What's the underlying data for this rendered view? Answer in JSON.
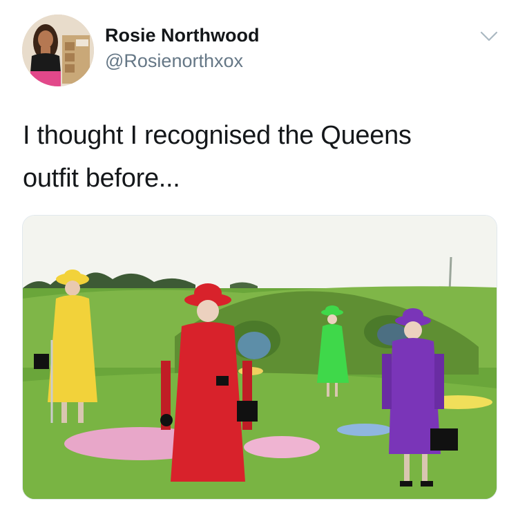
{
  "tweet": {
    "author_name": "Rosie Northwood",
    "author_handle": "@Rosienorthxox",
    "text_line1": "I thought I recognised the Queens",
    "text_line2": "outfit before...",
    "more_icon": "chevron-down-icon"
  },
  "media": {
    "type": "photo",
    "outfit_colors": {
      "yellow": "#f2d23a",
      "red": "#d8222b",
      "green": "#3fd84a",
      "purple": "#7a35b8"
    },
    "grass_color": "#6aa63a",
    "sky_color": "#f3f4ef"
  },
  "colors": {
    "text": "#14171a",
    "secondary_text": "#657786",
    "border": "#e1e8ed"
  }
}
